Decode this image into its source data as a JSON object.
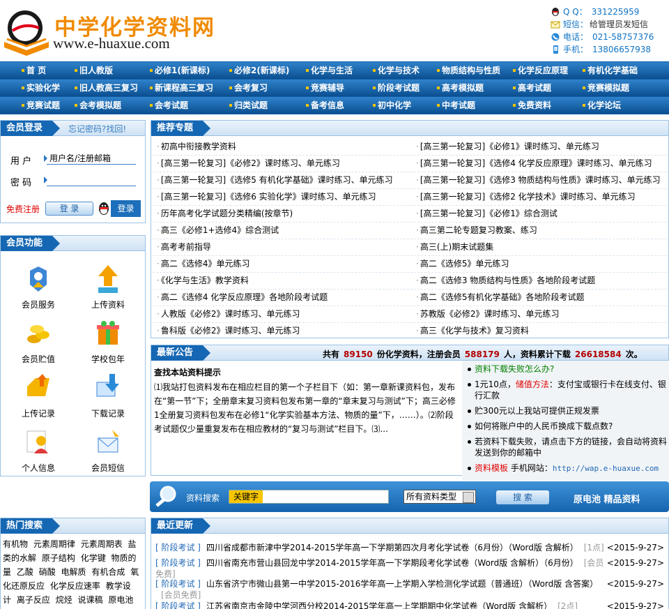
{
  "header": {
    "site_name": "中学化学资料网",
    "site_url": "www.e-huaxue.com",
    "contact": {
      "qq_label": "Q Q：",
      "qq_value": "331225959",
      "sms_label": "短信：",
      "sms_value": "给管理员发短信",
      "phone_label": "电话：",
      "phone_value": "021-58757376",
      "mobile_label": "手机：",
      "mobile_value": "13806657938"
    }
  },
  "nav": {
    "row1": [
      "首 页",
      "旧人教版",
      "必修1(新课标)",
      "必修2(新课标)",
      "化学与生活",
      "化学与技术",
      "物质结构与性质",
      "化学反应原理",
      "有机化学基础"
    ],
    "row2": [
      "实验化学",
      "旧人教高三复习",
      "新课程高三复习",
      "会考复习",
      "竞赛辅导",
      "阶段考试题",
      "高考模拟题",
      "高考试题",
      "竞赛模拟题"
    ],
    "row3": [
      "竞赛试题",
      "会考模拟题",
      "会考试题",
      "归类试题",
      "备考信息",
      "初中化学",
      "中考试题",
      "免费资料",
      "化学论坛"
    ]
  },
  "login": {
    "title": "会员登录",
    "forgot": "忘记密码?找回!",
    "user_label": "用  户",
    "user_placeholder": "用户名/注册邮箱",
    "pass_label": "密  码",
    "free_register": "免费注册",
    "login_button": "登 录",
    "qq_login_button": "登录"
  },
  "member": {
    "title": "会员功能",
    "items": [
      "会员服务",
      "上传资料",
      "会员贮值",
      "学校包年",
      "上传记录",
      "下载记录",
      "个人信息",
      "会员短信"
    ]
  },
  "topics": {
    "title": "推荐专题",
    "left": [
      "初高中衔接教学资料",
      "[高三第一轮复习]《必修2》课时练习、单元练习",
      "[高三第一轮复习]《选修5 有机化学基础》课时练习、单元练习",
      "[高三第一轮复习]《选修6 实验化学》课时练习、单元练习",
      "历年高考化学试题分类精编(按章节)",
      "高三《必修1+选修4》综合测试",
      "高考考前指导",
      "高二《选修4》单元练习",
      "《化学与生活》教学资料",
      "高二《选修4 化学反应原理》各地阶段考试题",
      "人教版《必修2》课时练习、单元练习",
      "鲁科版《必修2》课时练习、单元练习"
    ],
    "right": [
      "[高三第一轮复习]《必修1》课时练习、单元练习",
      "[高三第一轮复习]《选修4 化学反应原理》课时练习、单元练习",
      "[高三第一轮复习]《选修3 物质结构与性质》课时练习、单元练习",
      "[高三第一轮复习]《选修2 化学技术》课时练习、单元练习",
      "[高三第一轮复习]《必修1》综合测试",
      "高三第二轮专题复习教案、练习",
      "高三(上)期末试题集",
      "高二《选修5》单元练习",
      "高二《选修3 物质结构与性质》各地阶段考试题",
      "高二《选修5有机化学基础》各地阶段考试题",
      "苏教版《必修2》课时练习、单元练习",
      "高三《化学与技术》复习资料"
    ]
  },
  "announcement": {
    "title": "最新公告",
    "stats_prefix": "共有",
    "doc_count": "89150",
    "stats_mid1": "份化学资料，注册会员",
    "member_count": "588179",
    "stats_mid2": "人，资料累计下载",
    "download_count": "26618584",
    "stats_suffix": "次。",
    "notice_title": "查找本站资料提示",
    "notice_body": "⑴我站打包资料发布在相应栏目的第一个子栏目下（如：第一章新课资料包，发布在“第一节”下；全册章末复习资料包发布第一章的“章末复习与测试”下；高三必修1全册复习资料包发布在必修1“化学实验基本方法、物质的量”下，……）。⑵阶段考试题仅少量重复发布在相应教材的“复习与测试”栏目下。⑶...",
    "side": {
      "q1": "资料下载失败怎么办?",
      "a1_prefix": "1元10点，",
      "a1_link": "储值方法",
      "a1_suffix": "：支付宝或银行卡在线支付、银行汇款",
      "a2": "贮300元以上我站可提供正规发票",
      "q2": "如何将账户中的人民币换成下载点数?",
      "a3": "若资料下载失败，请点击下方的链接，会自动将资料发送到你的邮箱中",
      "tpl_link": "资料模板",
      "mobile_label": "手机网站：",
      "mobile_url": "http://wap.e-huaxue.com"
    }
  },
  "search": {
    "label": "资料搜索",
    "keyword_label": "关键字",
    "type_select": "所有资料类型",
    "button": "搜 索",
    "promo": "原电池 精品资料"
  },
  "hot_search": {
    "title": "热门搜索",
    "terms": [
      "有机物",
      "元素周期律",
      "元素周期表",
      "盐类的水解",
      "原子结构",
      "化学键",
      "物质的量",
      "乙酸",
      "硝酸",
      "电解质",
      "有机合成",
      "氧化还原反应",
      "化学反应速率",
      "教学设计",
      "离子反应",
      "烷烃",
      "说课稿",
      "原电池",
      "无机"
    ]
  },
  "updates": {
    "title": "最近更新",
    "items": [
      {
        "cat": "[ 阶段考试 ]",
        "title": "四川省成都市新津中学2014-2015学年高一下学期第四次月考化学试卷（6月份）（Word版 含解析）",
        "points": "[1点]",
        "date": "<2015-9-27>"
      },
      {
        "cat": "[ 阶段考试 ]",
        "title": "四川省南充市营山县回龙中学2014-2015学年高一下学期段考化学试卷（Word版 含解析）（6月份）",
        "points": "[会员免费]",
        "date": "<2015-9-27>"
      },
      {
        "cat": "[ 阶段考试 ]",
        "title": "山东省济宁市微山县第一中学2015-2016学年高一上学期入学检测化学试题（普通班）（Word版 含答案）",
        "points": "[会员免费]",
        "date": "<2015-9-27>"
      },
      {
        "cat": "[ 阶段考试 ]",
        "title": "江苏省南京市金陵中学河西分校2014-2015学年高一上学期期中化学试卷（Word版 含解析）",
        "points": "[2点]",
        "date": "<2015-9-27>"
      }
    ]
  },
  "colors": {
    "nav_blue": "#0e5ca3",
    "accent_orange": "#f08a00",
    "link_blue": "#1f68b4",
    "stat_red": "#b30000"
  }
}
